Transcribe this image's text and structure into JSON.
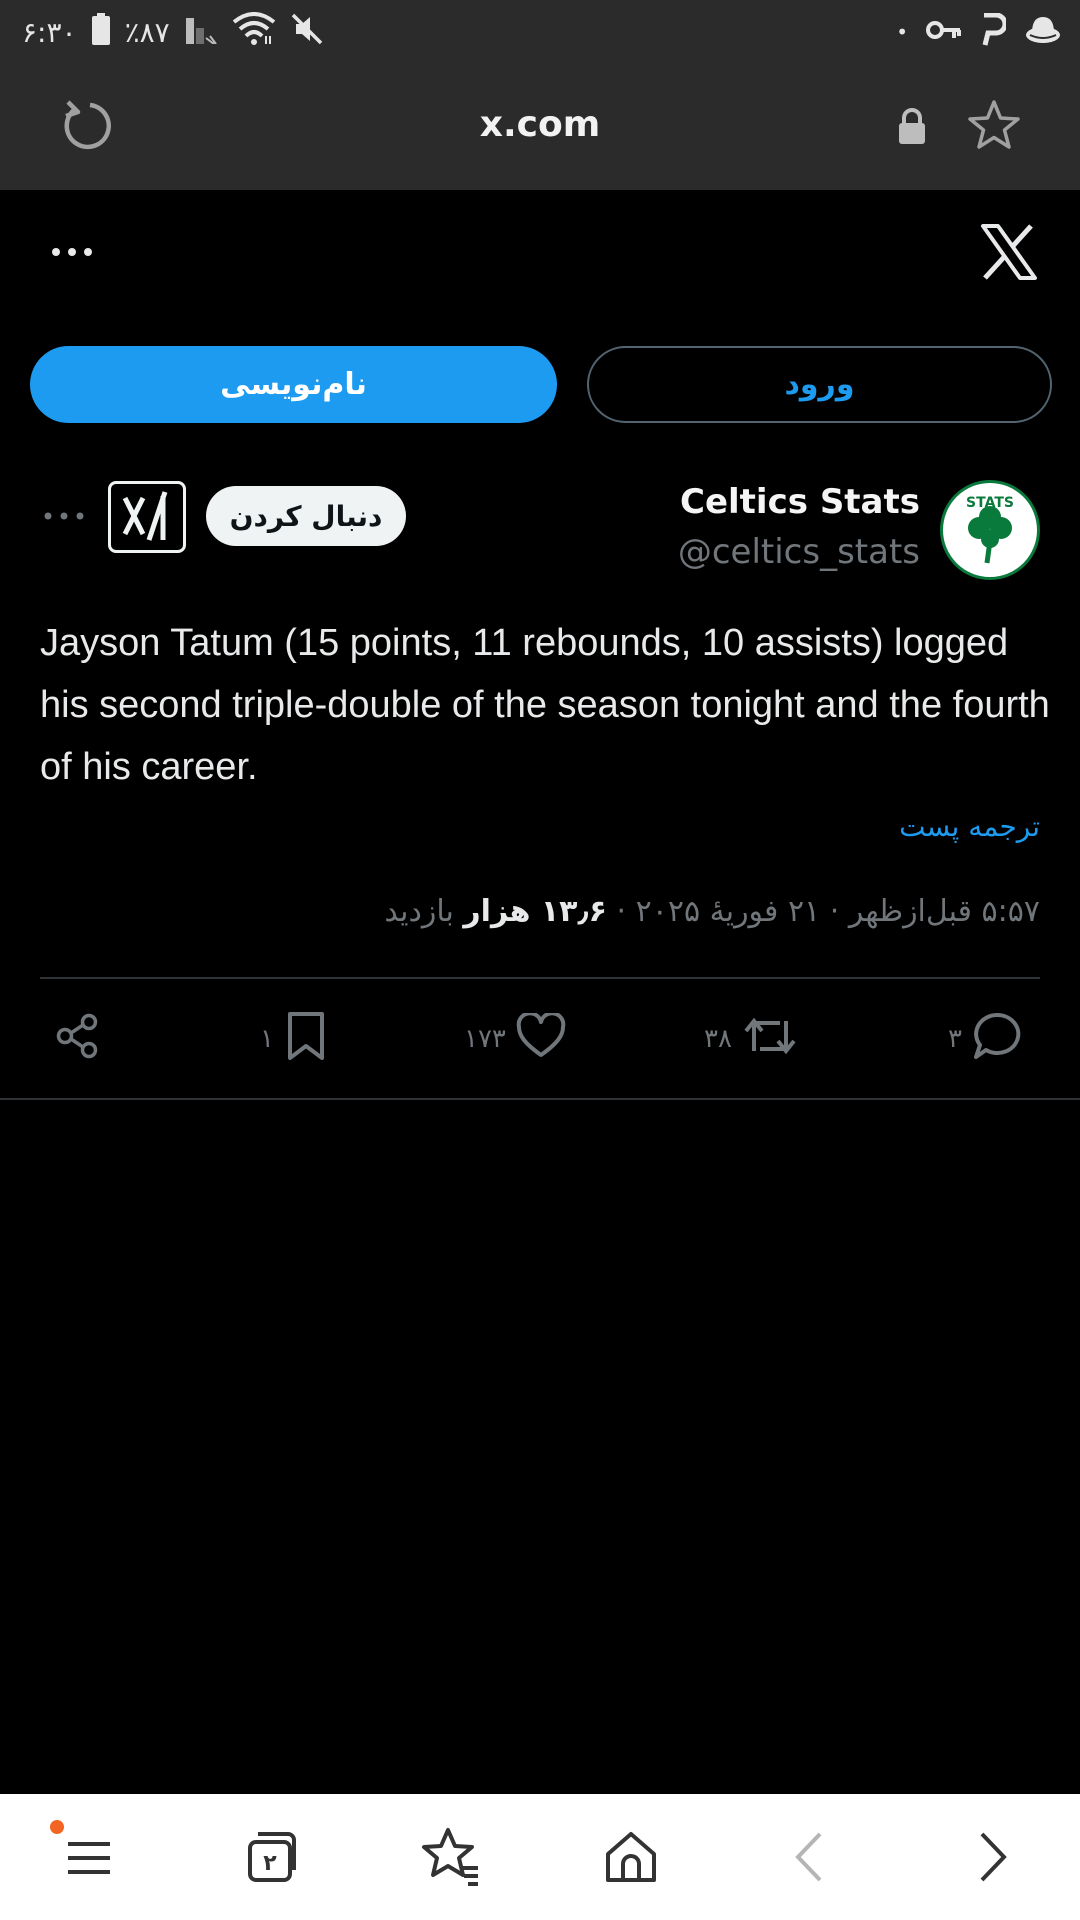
{
  "status_bar": {
    "time": "۶:۳۰",
    "battery": "٪۸۷",
    "dot": "•"
  },
  "browser": {
    "url": "x.com"
  },
  "auth": {
    "signup_label": "نام‌نویسی",
    "login_label": "ورود"
  },
  "post": {
    "display_name": "Celtics Stats",
    "handle": "@celtics_stats",
    "follow_label": "دنبال کردن",
    "avatar_text": "STATS",
    "text": "Jayson Tatum (15 points, 11 rebounds, 10 assists) logged his second triple-double of the season tonight and the fourth of his career.",
    "translate_label": "ترجمه پست",
    "time": "۵:۵۷ قبل‌ازظهر",
    "date": "۲۱ فوریهٔ ۲۰۲۵",
    "separator": "·",
    "views_count": "۱۳٫۶ هزار",
    "views_label": "بازدید",
    "replies": "۳",
    "reposts": "۳۸",
    "likes": "۱۷۳",
    "bookmarks": "۱"
  },
  "icons": {
    "reload": "reload-icon",
    "lock": "lock-icon",
    "star": "star-icon",
    "more": "more-icon",
    "x_logo": "x-logo-icon",
    "grok": "grok-icon",
    "reply": "reply-icon",
    "repost": "repost-icon",
    "like": "heart-icon",
    "bookmark": "bookmark-icon",
    "share": "share-icon",
    "menu": "menu-icon",
    "tabs": "tabs-icon",
    "bookmarks_nav": "bookmarks-icon",
    "home": "home-icon",
    "back": "back-icon",
    "forward": "forward-icon"
  },
  "tabs": {
    "count": "۲"
  },
  "colors": {
    "accent": "#1d9bf0",
    "background": "#000000",
    "muted": "#71767b",
    "notification_dot": "#f26522",
    "celtics_green": "#0a7a3c"
  }
}
